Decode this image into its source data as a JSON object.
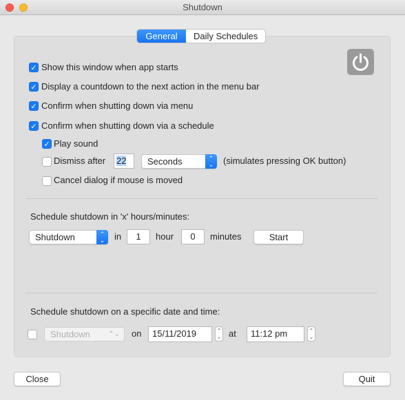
{
  "window": {
    "title": "Shutdown"
  },
  "tabs": [
    {
      "label": "General",
      "active": true
    },
    {
      "label": "Daily Schedules",
      "active": false
    }
  ],
  "options": [
    {
      "label": "Show this window when app starts",
      "checked": true
    },
    {
      "label": "Display a countdown to the next action in the menu bar",
      "checked": true
    },
    {
      "label": "Confirm when shutting down via menu",
      "checked": true
    },
    {
      "label": "Confirm when shutting down via a schedule",
      "checked": true
    }
  ],
  "sub_options": {
    "play_sound": {
      "label": "Play sound",
      "checked": true
    },
    "dismiss": {
      "label": "Dismiss after",
      "checked": false,
      "value": "22",
      "unit": "Seconds",
      "note": "(simulates pressing OK button)"
    },
    "cancel_mouse": {
      "label": "Cancel dialog if mouse is moved",
      "checked": false
    }
  },
  "relative": {
    "heading": "Schedule shutdown in 'x' hours/minutes:",
    "action": "Shutdown",
    "in_label": "in",
    "hours": "1",
    "hour_label": "hour",
    "minutes": "0",
    "minutes_label": "minutes",
    "start": "Start"
  },
  "specific": {
    "heading": "Schedule shutdown on a specific date and time:",
    "enabled": false,
    "action": "Shutdown",
    "on_label": "on",
    "date": "15/11/2019",
    "at_label": "at",
    "time": "11:12 pm"
  },
  "buttons": {
    "close": "Close",
    "quit": "Quit"
  },
  "colors": {
    "accent": "#1a7bf3",
    "close_light": "#fc5f57",
    "minimize_light": "#fdbc2e"
  }
}
